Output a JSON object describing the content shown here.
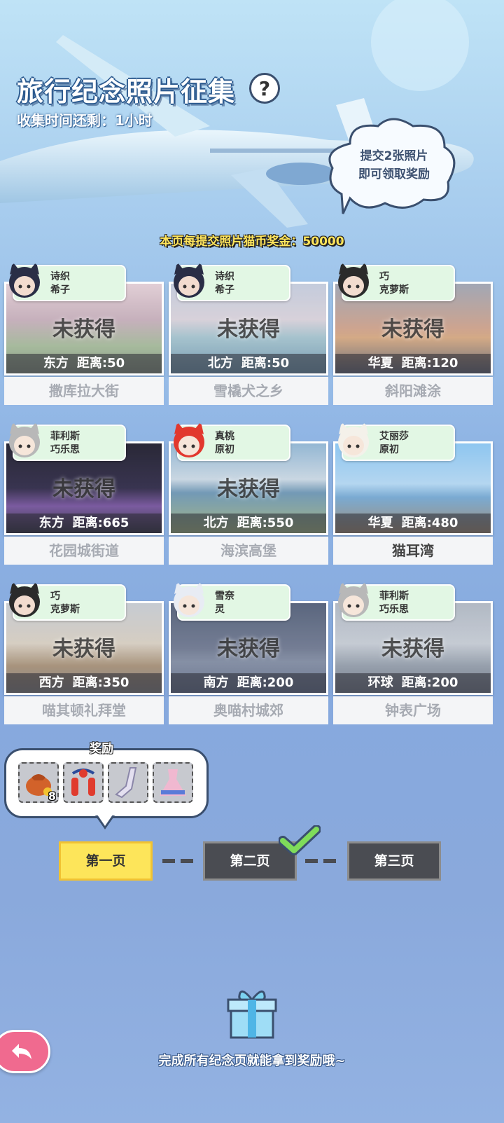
{
  "header": {
    "title": "旅行纪念照片征集",
    "help_icon": "?",
    "subtitle": "收集时间还剩：1小时",
    "cloud_line1": "提交2张照片",
    "cloud_line2": "即可领取奖励",
    "bonus": "本页每提交照片猫币奖金：50000"
  },
  "cards": [
    {
      "char1": "诗织",
      "char2": "希子",
      "status": "未获得",
      "dir": "东方",
      "dist": "距离:50",
      "name": "撒库拉大街"
    },
    {
      "char1": "诗织",
      "char2": "希子",
      "status": "未获得",
      "dir": "北方",
      "dist": "距离:50",
      "name": "雪橇犬之乡"
    },
    {
      "char1": "巧",
      "char2": "克萝斯",
      "status": "未获得",
      "dir": "华夏",
      "dist": "距离:120",
      "name": "斜阳滩涂"
    },
    {
      "char1": "菲利斯",
      "char2": "巧乐思",
      "status": "未获得",
      "dir": "东方",
      "dist": "距离:665",
      "name": "花园城街道"
    },
    {
      "char1": "真桃",
      "char2": "原初",
      "status": "未获得",
      "dir": "北方",
      "dist": "距离:550",
      "name": "海滨高堡"
    },
    {
      "char1": "艾丽莎",
      "char2": "原初",
      "status": "",
      "dir": "华夏",
      "dist": "距离:480",
      "name": "猫耳湾"
    },
    {
      "char1": "巧",
      "char2": "克萝斯",
      "status": "未获得",
      "dir": "西方",
      "dist": "距离:350",
      "name": "喵其顿礼拜堂"
    },
    {
      "char1": "雪奈",
      "char2": "灵",
      "status": "未获得",
      "dir": "南方",
      "dist": "距离:200",
      "name": "奥喵村城郊"
    },
    {
      "char1": "菲利斯",
      "char2": "巧乐思",
      "status": "未获得",
      "dir": "环球",
      "dist": "距离:200",
      "name": "钟表广场"
    }
  ],
  "rewards": {
    "label": "奖励",
    "items": [
      {
        "icon": "pouch-icon",
        "count": "8"
      },
      {
        "icon": "lantern-icon",
        "count": ""
      },
      {
        "icon": "stocking-icon",
        "count": ""
      },
      {
        "icon": "dress-icon",
        "count": ""
      }
    ]
  },
  "pages": {
    "p1": "第一页",
    "p2": "第二页",
    "p3": "第三页"
  },
  "footer": {
    "text": "完成所有纪念页就能拿到奖励哦~"
  },
  "colors": {
    "accent_yellow": "#fde55a",
    "tag_green": "#e2f7e4",
    "back_pink": "#f06a8f"
  }
}
